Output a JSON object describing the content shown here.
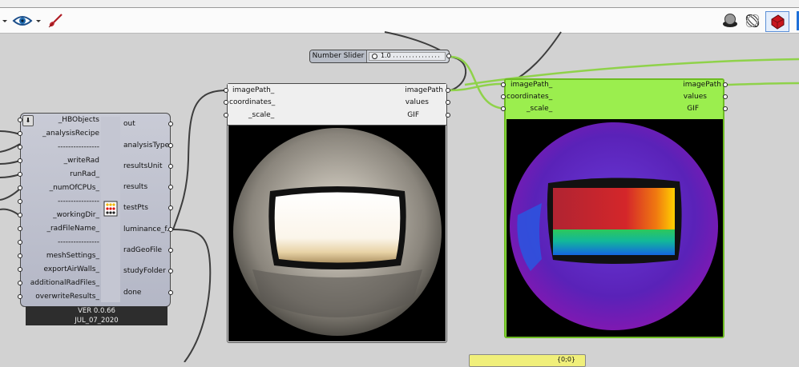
{
  "toolbar": {
    "left_icons": [
      "eye-icon",
      "paint-brush-icon"
    ],
    "right_icons": [
      "preview-shaded-icon",
      "preview-wire-icon",
      "preview-selected-icon"
    ]
  },
  "number_slider": {
    "label": "Number Slider",
    "value": "1.0"
  },
  "hb_component": {
    "inputs": [
      "_HBObjects",
      "_analysisRecipe",
      "----------------",
      "_writeRad",
      "runRad_",
      "_numOfCPUs_",
      "----------------",
      "_workingDir_",
      "_radFileName_",
      "----------------",
      "meshSettings_",
      "exportAirWalls_",
      "additionalRadFiles_",
      "overwriteResults_"
    ],
    "outputs": [
      "out",
      "analysisType",
      "resultsUnit",
      "results",
      "testPts",
      "luminance_f...",
      "radGeoFile",
      "studyFolder",
      "done"
    ],
    "version": "VER 0.0.66",
    "date": "JUL_07_2020"
  },
  "image_viewer_1": {
    "inputs": [
      "imagePath_",
      "coordinates_",
      "_scale_"
    ],
    "outputs": [
      "imagePath",
      "values",
      "GIF"
    ]
  },
  "image_viewer_2": {
    "inputs": [
      "imagePath_",
      "coordinates_",
      "_scale_"
    ],
    "outputs": [
      "imagePath",
      "values",
      "GIF"
    ]
  },
  "panel": {
    "text": "{0;0}"
  },
  "colors": {
    "canvas": "#d2d2d2",
    "wire": "#3d3d3d",
    "selected_wire": "#8fd24a",
    "selected_component": "#9bee4e",
    "panel": "#f0ef7a"
  }
}
